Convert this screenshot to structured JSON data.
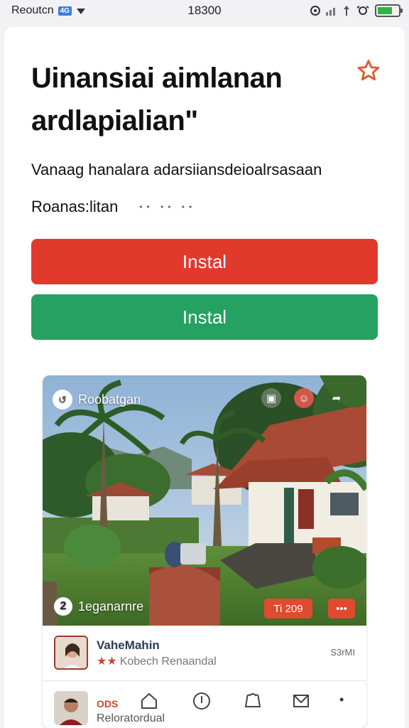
{
  "status_bar": {
    "carrier": "Reoutcn",
    "badge": "4G",
    "time": "18300",
    "battery_level": 0.7
  },
  "app": {
    "title_line1": "Uinansiai aimlanan",
    "title_line2": "ardlapialian\"",
    "description": "Vanaag hanalara adarsiiansdeioalrsasaan",
    "rating_label": "Roanas:litan",
    "rating_dots": "•• •• ••",
    "install_primary": "Instal",
    "install_secondary": "Instal"
  },
  "media": {
    "scene_label": "Roobatgan",
    "counter": "2",
    "counter_label": "1eganarnre",
    "pill_a": "Ti 209",
    "pill_b": "•••"
  },
  "author": {
    "name": "VaheMahin",
    "subtitle_prefix": "★★",
    "subtitle": "Kobech Renaandal",
    "meta": "S3rMI"
  },
  "bottom_bar": {
    "tag": "ODS",
    "label": "Reloratordual",
    "more": "•"
  },
  "colors": {
    "install_red": "#e2392d",
    "install_green": "#25a162",
    "star_orange": "#e0592e"
  }
}
